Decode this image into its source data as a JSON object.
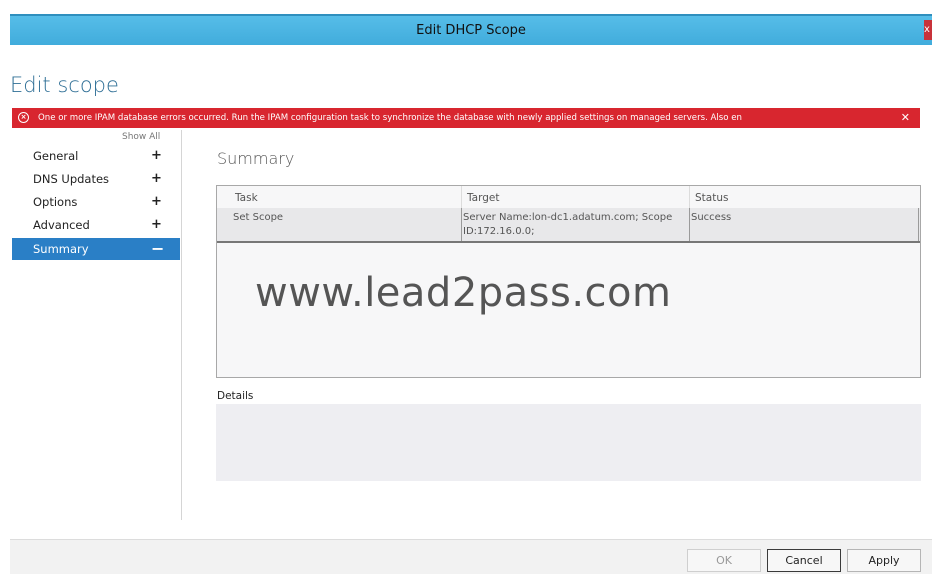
{
  "window": {
    "title": "Edit DHCP Scope"
  },
  "page": {
    "heading": "Edit scope"
  },
  "error": {
    "message": "One or more IPAM database errors occurred. Run the IPAM configuration task to synchronize the database with newly applied settings on managed servers. Also en",
    "close_glyph": "✕",
    "color": "#d8262f"
  },
  "sidebar": {
    "show_all": "Show All",
    "items": [
      {
        "label": "General",
        "expander": "+"
      },
      {
        "label": "DNS Updates",
        "expander": "+"
      },
      {
        "label": "Options",
        "expander": "+"
      },
      {
        "label": "Advanced",
        "expander": "+"
      },
      {
        "label": "Summary",
        "expander": "−"
      }
    ],
    "active_color": "#2a7fc6"
  },
  "main": {
    "section_title": "Summary",
    "table": {
      "columns": [
        "Task",
        "Target",
        "Status"
      ],
      "rows": [
        {
          "task": "Set Scope",
          "target_line1": "Server Name:lon-dc1.adatum.com; Scope",
          "target_line2": "ID:172.16.0.0;",
          "status": "Success"
        }
      ]
    },
    "watermark": "www.lead2pass.com",
    "details_label": "Details"
  },
  "buttons": {
    "ok": "OK",
    "cancel": "Cancel",
    "apply": "Apply"
  },
  "titlebar_color": "#41acdc"
}
